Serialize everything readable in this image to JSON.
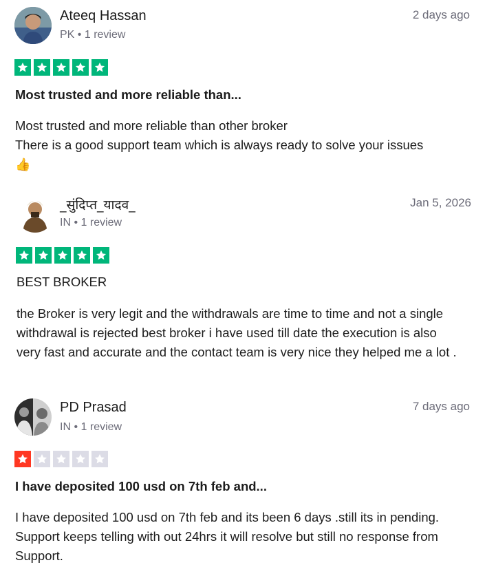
{
  "reviews": [
    {
      "name": "Ateeq Hassan",
      "country": "PK",
      "review_count": "1 review",
      "date": "2 days ago",
      "rating": 5,
      "title": "Most trusted and more reliable than...",
      "body_lines": [
        "Most trusted and more reliable than other broker",
        "There is a good support team which is always ready to solve your issues"
      ],
      "emoji": "👍"
    },
    {
      "name": "_सुंदिप्त_यादव_",
      "country": "IN",
      "review_count": "1 review",
      "date": "Jan 5, 2026",
      "rating": 5,
      "title": "BEST BROKER",
      "body": "the Broker is very legit and the withdrawals are time to time and not a single withdrawal is rejected best broker i have used till date the execution is also very fast and accurate and the contact team is very nice they helped me a lot ."
    },
    {
      "name": "PD Prasad",
      "country": "IN",
      "review_count": "1 review",
      "date": "7 days ago",
      "rating": 1,
      "title": "I have deposited 100 usd on 7th feb and...",
      "body": "I have deposited 100 usd on 7th feb and its been 6 days .still its in pending. Support keeps telling with out 24hrs it will resolve but still no response from Support."
    }
  ],
  "separator": "•",
  "colors": {
    "five_star": "#00b67a",
    "one_star": "#ff3722",
    "empty_star": "#dcdce6",
    "muted_text": "#6b6b78"
  }
}
